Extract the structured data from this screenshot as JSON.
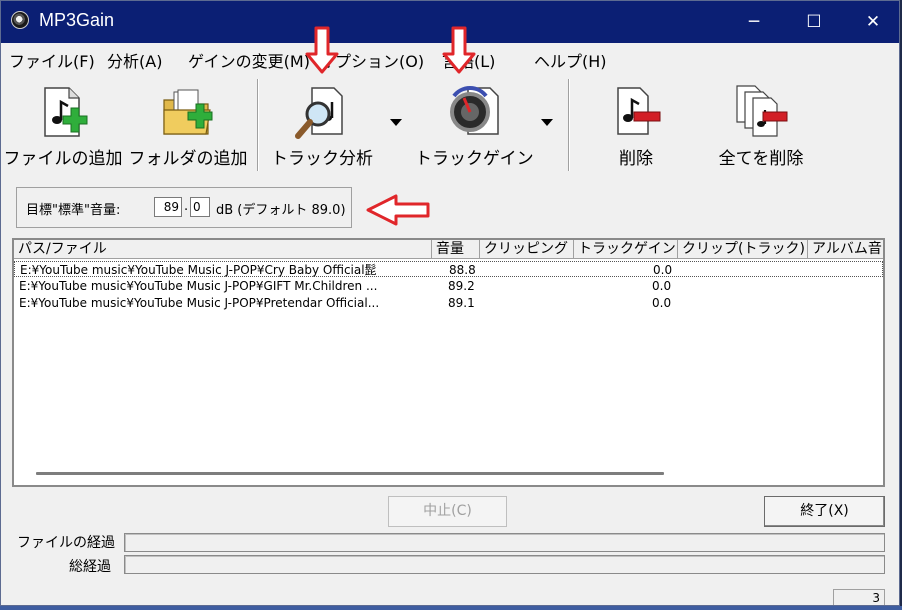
{
  "window": {
    "title": "MP3Gain",
    "minimize": "─",
    "maximize": "☐",
    "close": "✕"
  },
  "menu": {
    "file": "ファイル(F)",
    "analysis": "分析(A)",
    "gain_change": "ゲインの変更(M)",
    "options": "オプション(O)",
    "language": "言語(L)",
    "help": "ヘルプ(H)"
  },
  "toolbar": {
    "add_file": "ファイルの追加",
    "add_folder": "フォルダの追加",
    "track_analysis": "トラック分析",
    "track_gain": "トラックゲイン",
    "delete": "削除",
    "delete_all": "全てを削除"
  },
  "target": {
    "label": "目標\"標準\"音量:",
    "value_int": "89",
    "value_frac": "0",
    "unit": "dB (デフォルト 89.0)"
  },
  "list": {
    "columns": [
      "パス/ファイル",
      "音量",
      "クリッピング",
      "トラックゲイン",
      "クリップ(トラック)",
      "アルバム音"
    ],
    "rows": [
      {
        "path": "E:¥YouTube music¥YouTube Music J-POP¥Cry Baby  Official髭",
        "volume": "88.8",
        "track_gain": "0.0"
      },
      {
        "path": "E:¥YouTube music¥YouTube Music J-POP¥GIFT  Mr.Children ...",
        "volume": "89.2",
        "track_gain": "0.0"
      },
      {
        "path": "E:¥YouTube music¥YouTube Music J-POP¥Pretendar  Official...",
        "volume": "89.1",
        "track_gain": "0.0"
      }
    ]
  },
  "buttons": {
    "abort": "中止(C)",
    "exit": "終了(X)"
  },
  "progress": {
    "file_label": "ファイルの経過",
    "total_label": "総経過"
  },
  "status": {
    "count": "3"
  },
  "colors": {
    "titlebar": "#0b1f74",
    "annotation_arrow": "#e0262a",
    "remove_bar": "#d21f26",
    "add_plus": "#2fae3b"
  }
}
